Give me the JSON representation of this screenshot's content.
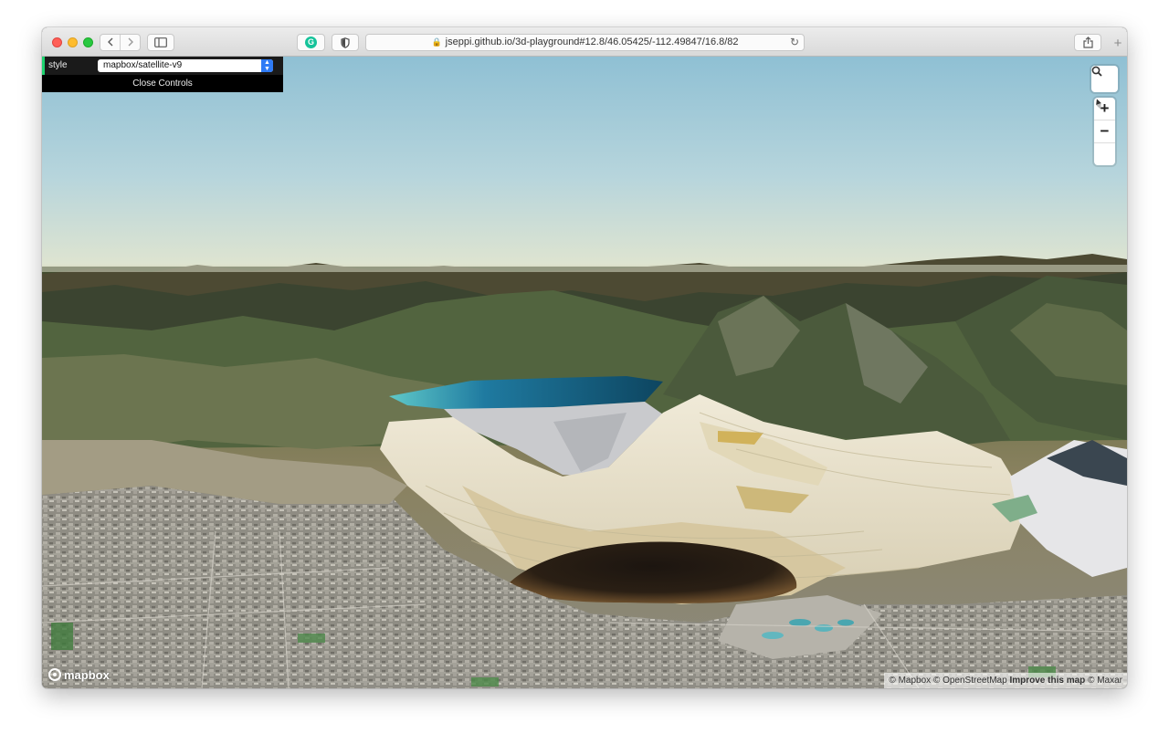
{
  "browser": {
    "url": "jseppi.github.io/3d-playground#12.8/46.05425/-112.49847/16.8/82",
    "back_icon": "chevron-left-icon",
    "forward_icon": "chevron-right-icon",
    "newtab_label": "+"
  },
  "controls": {
    "style_label": "style",
    "style_value": "mapbox/satellite-v9",
    "close_label": "Close Controls"
  },
  "map_controls": {
    "zoom_in": "+",
    "zoom_out": "−"
  },
  "logo": {
    "text": "mapbox"
  },
  "attribution": {
    "mapbox": "© Mapbox",
    "osm": "© OpenStreetMap",
    "improve": "Improve this map",
    "maxar": "© Maxar"
  },
  "colors": {
    "sky_top": "#8fc0d4",
    "sky_horizon": "#e3e6cf",
    "accent_green": "#1ed36f",
    "select_blue": "#2f7bf5"
  }
}
